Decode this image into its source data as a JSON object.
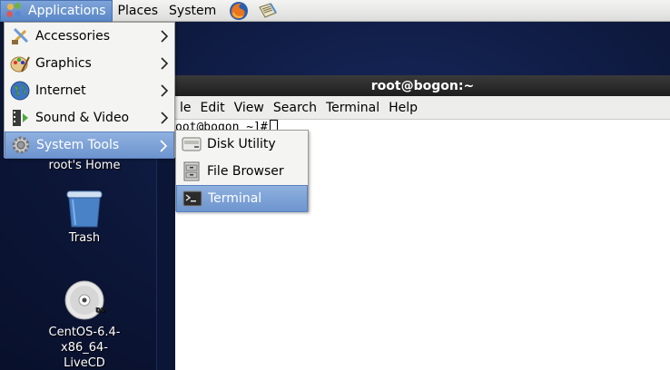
{
  "top_panel": {
    "applications": "Applications",
    "places": "Places",
    "system": "System",
    "launchers": [
      "firefox-icon",
      "notes-icon"
    ]
  },
  "desktop_icons": [
    {
      "label": "root's Home",
      "icon": "home-folder-icon"
    },
    {
      "label": "Trash",
      "icon": "trash-icon"
    },
    {
      "label": "CentOS-6.4-x86_64-",
      "label2": "LiveCD",
      "icon": "dvd-icon",
      "badge": "DVD"
    }
  ],
  "apps_menu": {
    "items": [
      {
        "label": "Accessories",
        "icon": "accessories-icon"
      },
      {
        "label": "Graphics",
        "icon": "graphics-icon"
      },
      {
        "label": "Internet",
        "icon": "internet-globe-icon"
      },
      {
        "label": "Sound & Video",
        "icon": "sound-video-icon"
      },
      {
        "label": "System Tools",
        "icon": "system-tools-gear-icon",
        "highlighted": true
      }
    ]
  },
  "system_tools_menu": {
    "items": [
      {
        "label": "Disk Utility",
        "icon": "disk-utility-icon"
      },
      {
        "label": "File Browser",
        "icon": "file-cabinet-icon"
      },
      {
        "label": "Terminal",
        "icon": "terminal-icon",
        "highlighted": true
      }
    ]
  },
  "terminal": {
    "title": "root@bogon:~",
    "menus": [
      "le",
      "Edit",
      "View",
      "Search",
      "Terminal",
      "Help"
    ],
    "prompt": "oot@bogon ~]#"
  },
  "colors": {
    "highlight": "#6d95cf",
    "desktop": "#0d1a3f",
    "titlebar": "#2a2a2a"
  }
}
